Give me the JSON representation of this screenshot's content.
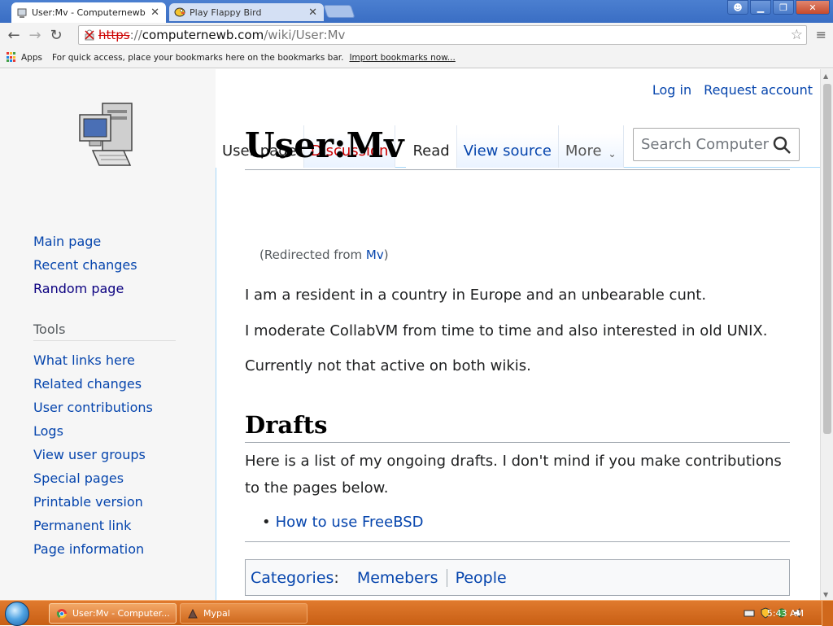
{
  "browser": {
    "tabs": [
      {
        "title": "User:Mv - Computernewb W",
        "active": true
      },
      {
        "title": "Play Flappy Bird",
        "active": false
      }
    ],
    "url": {
      "scheme": "https",
      "separator": "://",
      "host": "computernewb.com",
      "path": "/wiki/User:Mv"
    },
    "bookmarks_bar": {
      "apps_label": "Apps",
      "hint": "For quick access, place your bookmarks here on the bookmarks bar.",
      "import_label": "Import bookmarks now..."
    }
  },
  "wiki": {
    "personal": {
      "login": "Log in",
      "request": "Request account"
    },
    "tabs": {
      "user_page": "User page",
      "discussion": "Discussion",
      "read": "Read",
      "view_source": "View source",
      "more": "More"
    },
    "search_placeholder": "Search Computer",
    "sidebar": {
      "nav": [
        "Main page",
        "Recent changes",
        "Random page"
      ],
      "tools_heading": "Tools",
      "tools": [
        "What links here",
        "Related changes",
        "User contributions",
        "Logs",
        "View user groups",
        "Special pages",
        "Printable version",
        "Permanent link",
        "Page information"
      ]
    },
    "title": "User:Mv",
    "redirect": {
      "prefix": "(Redirected from ",
      "link": "Mv",
      "suffix": ")"
    },
    "paragraphs": [
      "I am a resident in a country in Europe and an unbearable cunt.",
      "I moderate CollabVM from time to time and also interested in old UNIX.",
      "Currently not that active on both wikis."
    ],
    "section_heading": "Drafts",
    "drafts_text": "Here is a list of my ongoing drafts. I don't mind if you make contributions to the pages below.",
    "draft_links": [
      "How to use FreeBSD"
    ],
    "categories": {
      "label": "Categories",
      "items": [
        "Memebers",
        "People"
      ]
    }
  },
  "taskbar": {
    "tasks": [
      "User:Mv - Computer...",
      "Mypal"
    ],
    "clock": "5:43 AM"
  },
  "colors": {
    "link": "#0645ad",
    "link_visited": "#0b0080",
    "new_link": "#c00",
    "taskbar": "#d9742e"
  }
}
